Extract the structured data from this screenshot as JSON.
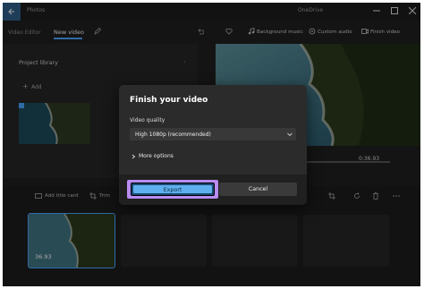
{
  "titlebar": {
    "app_title": "Photos",
    "onedrive": "OneDrive"
  },
  "toolbar": {
    "tab_video_editor": "Video Editor",
    "tab_new_video": "New video",
    "background_music": "Background music",
    "custom_audio": "Custom audio",
    "finish_video": "Finish video"
  },
  "library": {
    "title": "Project library",
    "add": "Add"
  },
  "player": {
    "time": "0:36.93"
  },
  "storyboard": {
    "add_title_card": "Add title card",
    "trim": "Trim",
    "clip_duration": "36.93"
  },
  "dialog": {
    "title": "Finish your video",
    "quality_label": "Video quality",
    "quality_value": "High 1080p (recommended)",
    "more_options": "More options",
    "export": "Export",
    "cancel": "Cancel"
  },
  "colors": {
    "accent": "#4aa3ff",
    "highlight": "#b98cf2",
    "export_button": "#5fb0ee"
  }
}
